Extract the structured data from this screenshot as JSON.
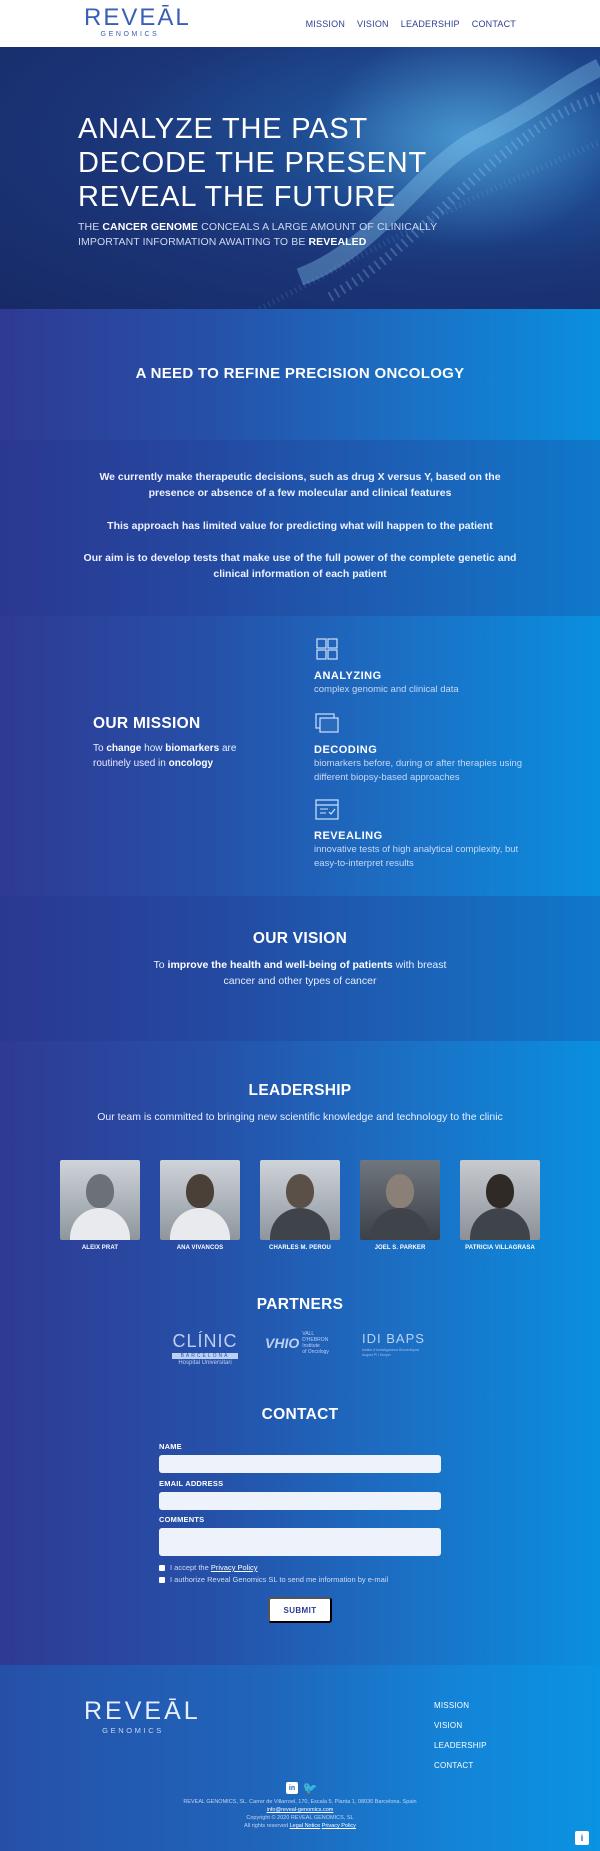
{
  "header": {
    "logo_word": "REVEĀL",
    "logo_sub": "GENOMICS",
    "nav": [
      "MISSION",
      "VISION",
      "LEADERSHIP",
      "CONTACT"
    ]
  },
  "hero": {
    "line1": "ANALYZE THE PAST",
    "line2": "DECODE THE PRESENT",
    "line3": "REVEAL THE FUTURE",
    "sub_pre": "THE ",
    "sub_b1": "CANCER GENOME",
    "sub_mid": " CONCEALS A LARGE AMOUNT OF CLINICALLY IMPORTANT INFORMATION AWAITING TO BE ",
    "sub_b2": "REVEALED"
  },
  "need": {
    "title": "A NEED TO REFINE PRECISION ONCOLOGY",
    "p1": "We currently make therapeutic decisions, such as drug X versus Y, based on the presence or absence of a few molecular and clinical features",
    "p2": "This approach has limited value for predicting what will happen to the patient",
    "p3": "Our aim is to develop tests that make use of the full power of the complete genetic and clinical information of each patient"
  },
  "mission": {
    "title": "OUR MISSION",
    "t1": "To ",
    "b1": "change",
    "t2": " how ",
    "b2": "biomarkers",
    "t3": " are routinely used in ",
    "b3": "oncology",
    "pillars": [
      {
        "icon": "grid-icon",
        "title": "ANALYZING",
        "text": "complex genomic and clinical data"
      },
      {
        "icon": "stack-icon",
        "title": "DECODING",
        "text": "biomarkers before, during or after therapies using different biopsy-based approaches"
      },
      {
        "icon": "checklist-icon",
        "title": "REVEALING",
        "text": "innovative tests of high analytical complexity, but easy-to-interpret results"
      }
    ]
  },
  "vision": {
    "title": "OUR VISION",
    "t1": "To ",
    "b1": "improve the health and well-being of patients",
    "t2": " with breast cancer and other types of cancer"
  },
  "leadership": {
    "title": "LEADERSHIP",
    "text": "Our team is committed to bringing new scientific knowledge and technology to the clinic",
    "members": [
      {
        "name": "ALEIX PRAT"
      },
      {
        "name": "ANA VIVANCOS"
      },
      {
        "name": "CHARLES M. PEROU"
      },
      {
        "name": "JOEL S. PARKER"
      },
      {
        "name": "PATRICIA VILLAGRASA"
      }
    ]
  },
  "partners": {
    "title": "PARTNERS",
    "clinic_big": "CLÍNIC",
    "clinic_bar": "BARCELONA",
    "clinic_sm": "Hospital Universitari",
    "vhio_big": "VHIO",
    "vhio_sm1": "VALL D'HEBRON",
    "vhio_sm2": "Institute",
    "vhio_sm3": "of Oncology",
    "idibaps_big": "IDI BAPS",
    "idibaps_sm": "Institut d'Investigacions Biomèdiques August Pi i Sunyer"
  },
  "contact": {
    "title": "CONTACT",
    "name_label": "NAME",
    "email_label": "EMAIL ADDRESS",
    "comments_label": "COMMENTS",
    "accept_pre": "I accept the ",
    "accept_link": "Privacy Policy",
    "authorize": "I authorize Reveal Genomics SL to send me information by e-mail",
    "submit": "SUBMIT"
  },
  "footer": {
    "logo_word": "REVEĀL",
    "logo_sub": "GENOMICS",
    "nav": [
      "MISSION",
      "VISION",
      "LEADERSHIP",
      "CONTACT"
    ],
    "social": [
      "in",
      "🐦"
    ],
    "line1": "REVEAL GENOMICS, SL. Carrer de Villarroel, 170, Escala 5, Planta 1, 08036 Barcelona. Spain",
    "line2": "info@reveal-genomics.com",
    "line3": "Copyright © 2020 REVEAL GENOMICS, SL",
    "line4_pre": "All rights reserved ",
    "line4_l1": "Legal Notice",
    "line4_l2": "Privacy Policy",
    "corner": "i"
  }
}
